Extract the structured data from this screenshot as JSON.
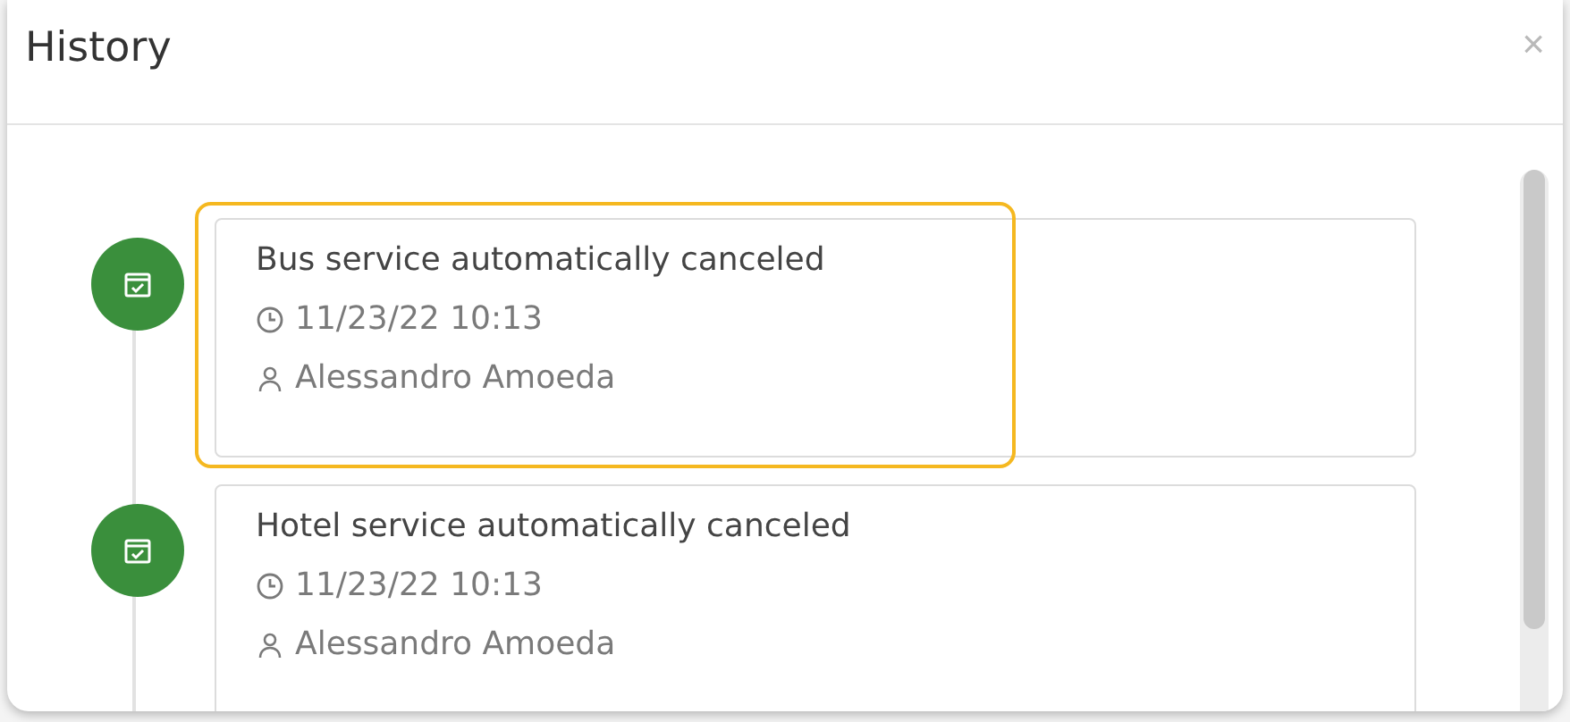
{
  "dialog": {
    "title": "History",
    "close": "×"
  },
  "events": [
    {
      "title": "Bus service automatically canceled",
      "time": "11/23/22 10:13",
      "user": "Alessandro Amoeda",
      "selected": true
    },
    {
      "title": "Hotel service automatically canceled",
      "time": "11/23/22 10:13",
      "user": "Alessandro Amoeda",
      "selected": false
    }
  ]
}
